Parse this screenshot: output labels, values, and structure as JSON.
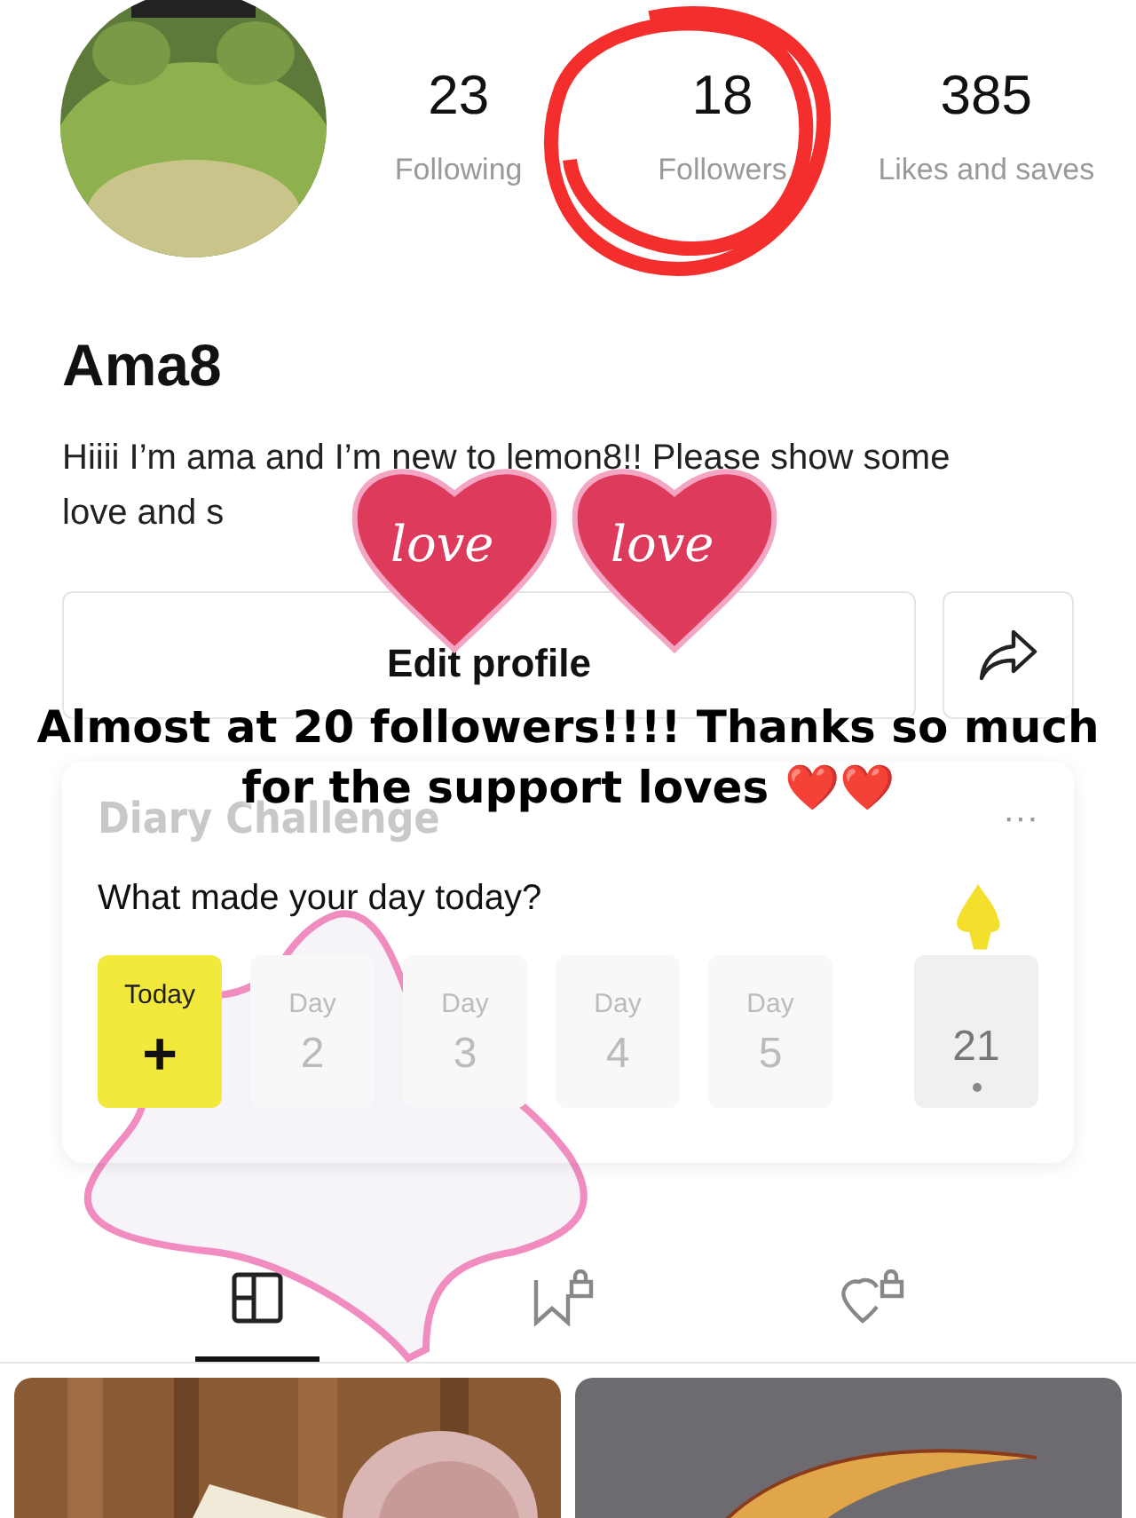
{
  "profile": {
    "name": "Ama8",
    "bio": "Hiiii I’m ama and I’m new to lemon8!! Please show some love and s"
  },
  "stats": [
    {
      "value": "23",
      "label": "Following"
    },
    {
      "value": "18",
      "label": "Followers"
    },
    {
      "value": "385",
      "label": "Likes and saves"
    }
  ],
  "buttons": {
    "edit": "Edit profile"
  },
  "diary": {
    "title": "Diary Challenge",
    "more": "···",
    "prompt": "What made your day today?",
    "days": [
      {
        "kind": "today",
        "label": "Today",
        "value": "+"
      },
      {
        "kind": "day",
        "label": "Day",
        "value": "2"
      },
      {
        "kind": "day",
        "label": "Day",
        "value": "3"
      },
      {
        "kind": "day",
        "label": "Day",
        "value": "4"
      },
      {
        "kind": "day",
        "label": "Day",
        "value": "5"
      },
      {
        "kind": "current",
        "value": "21"
      }
    ]
  },
  "tabs": [
    {
      "kind": "grid",
      "selected": true
    },
    {
      "kind": "bookmark",
      "selected": false
    },
    {
      "kind": "heart",
      "selected": false
    }
  ],
  "overlay": {
    "caption": "Almost at 20 followers!!!! Thanks so much for the support loves ❤️❤️",
    "stickers": [
      "love",
      "love"
    ]
  }
}
